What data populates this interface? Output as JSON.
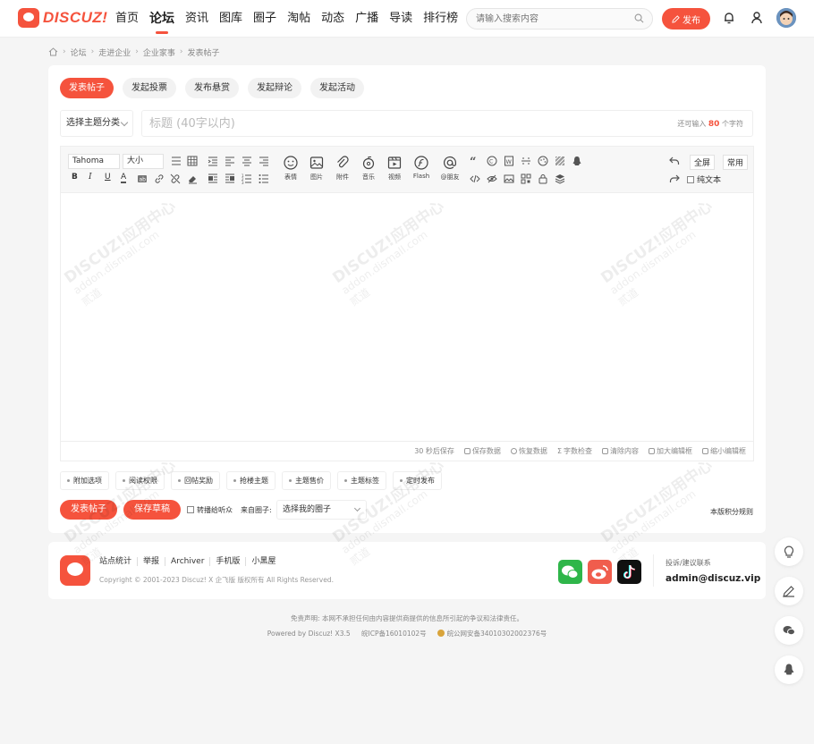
{
  "header": {
    "logo_text": "DISCUZ!",
    "nav": [
      "首页",
      "论坛",
      "资讯",
      "图库",
      "圈子",
      "淘帖",
      "动态",
      "广播",
      "导读",
      "排行榜"
    ],
    "active_nav": "论坛",
    "search_placeholder": "请输入搜索内容",
    "publish_label": "发布"
  },
  "breadcrumb": [
    "论坛",
    "走进企业",
    "企业家事",
    "发表帖子"
  ],
  "post": {
    "tabs": [
      "发表帖子",
      "发起投票",
      "发布悬赏",
      "发起辩论",
      "发起活动"
    ],
    "active_tab": "发表帖子",
    "category_select": "选择主题分类",
    "title_placeholder": "标题 (40字以内)",
    "counter_prefix": "还可输入",
    "counter_value": "80",
    "counter_suffix": "个字符"
  },
  "editor": {
    "font_select": "Tahoma",
    "size_select": "大小",
    "big_tools": [
      "表情",
      "图片",
      "附件",
      "音乐",
      "视频",
      "Flash",
      "@朋友"
    ],
    "fullscreen": "全屏",
    "common": "常用",
    "plain_text": "纯文本",
    "status": {
      "autosave": "30 秒后保存",
      "save_data": "保存数据",
      "restore": "恢复数据",
      "word_check": "字数检查",
      "clear": "清除内容",
      "enlarge": "加大编辑框",
      "shrink": "缩小编辑框"
    }
  },
  "extras": [
    "附加选项",
    "阅读权限",
    "回帖奖励",
    "抢楼主题",
    "主题售价",
    "主题标签",
    "定时发布"
  ],
  "actions": {
    "submit": "发表帖子",
    "draft": "保存草稿",
    "forward": "转播给听众",
    "from_circle_label": "来自圈子:",
    "circle_select": "选择我的圈子",
    "rules_link": "本版积分规则"
  },
  "footer": {
    "links": [
      "站点统计",
      "举报",
      "Archiver",
      "手机版",
      "小黑屋"
    ],
    "copyright": "Copyright © 2001-2023 Discuz! X 企飞版 版权所有 All Rights Reserved.",
    "contact_label": "投诉/建议联系",
    "contact_email": "admin@discuz.vip",
    "social": [
      "wechat-icon",
      "weibo-icon",
      "douyin-icon"
    ]
  },
  "disclaimer": "免责声明: 本网不承担任何由内容提供商提供的信息所引起的争议和法律责任。",
  "powered": "Powered by Discuz! X3.5",
  "icp": "皖ICP备16010102号",
  "police": "皖公网安备34010302002376号",
  "watermark": {
    "line1": "DISCUZ!应用中心",
    "line2": "addon.dismall.com",
    "line3": "贰道"
  },
  "colors": {
    "accent": "#f5533d",
    "wechat": "#2fb64a",
    "weibo": "#f05d4d",
    "douyin": "#111111"
  }
}
